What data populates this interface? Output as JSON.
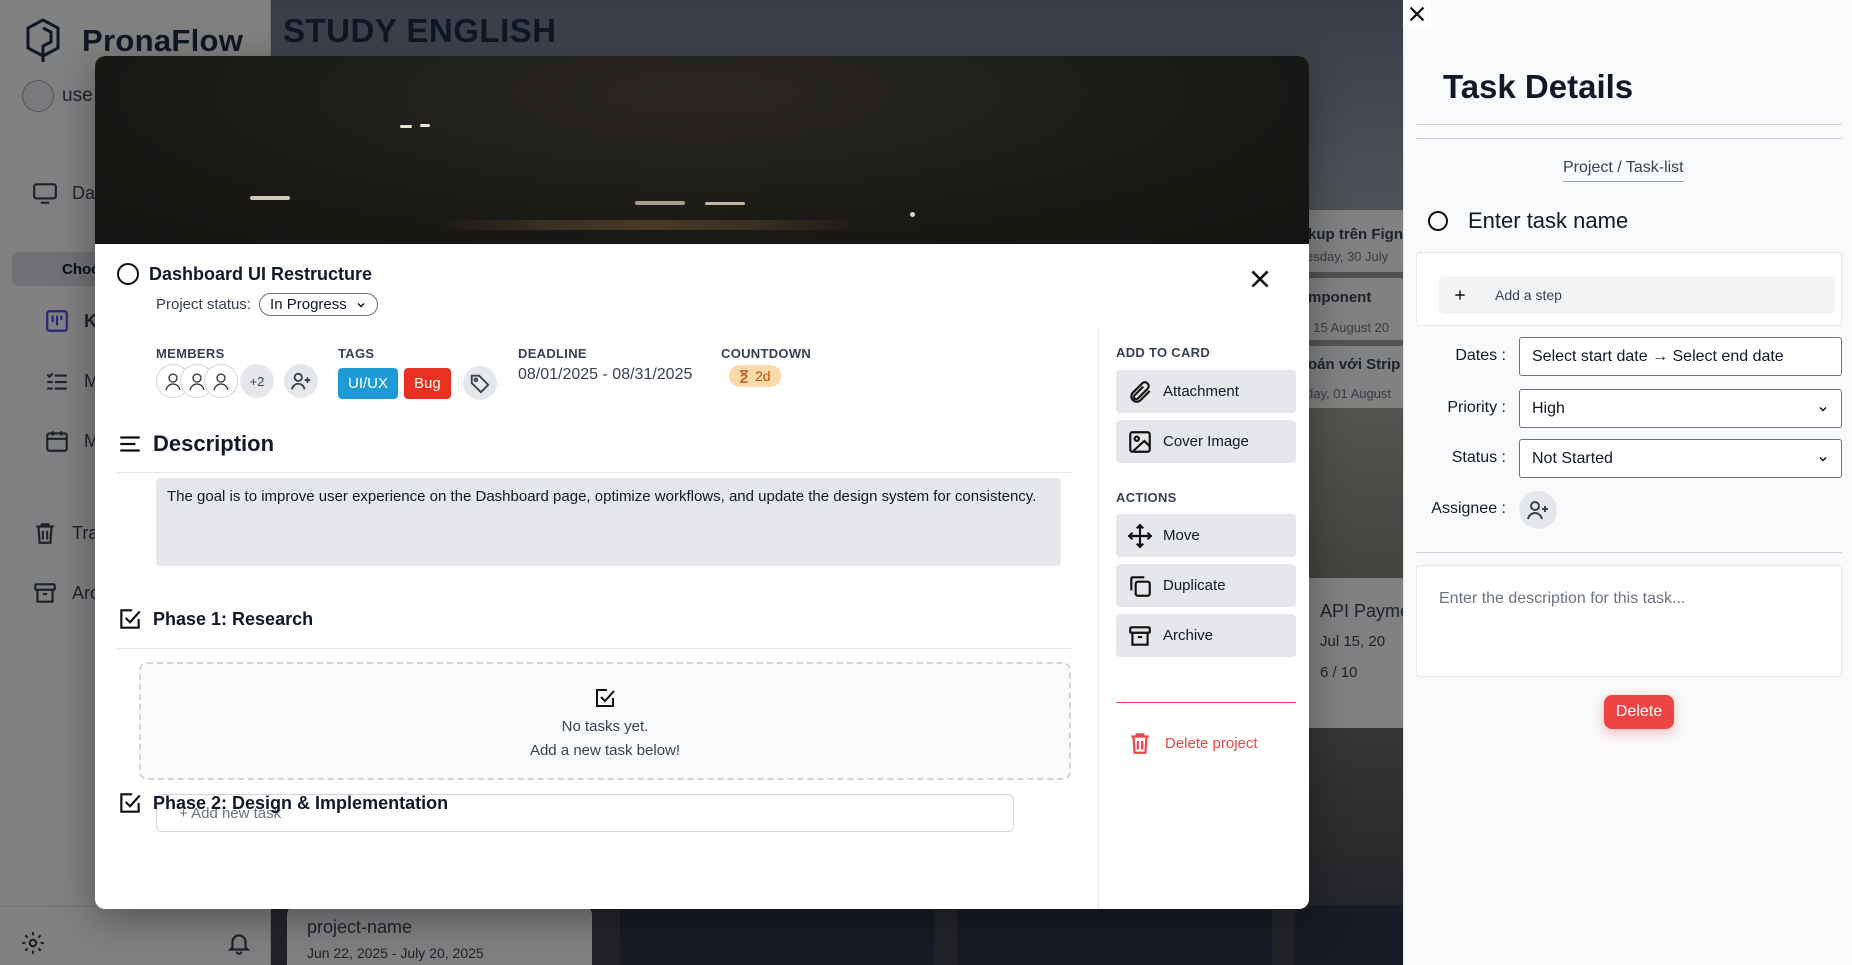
{
  "app": {
    "logo_text": "PronaFlow",
    "user_label": "use",
    "board_title": "STUDY ENGLISH",
    "sidebar": [
      {
        "label": "Das"
      },
      {
        "label": "Choo"
      },
      {
        "label": "Ka"
      },
      {
        "label": "M"
      },
      {
        "label": "M"
      },
      {
        "label": "Tra"
      },
      {
        "label": "Arc"
      }
    ],
    "background_cards": {
      "card_a": "kup trên Fign",
      "card_a_date": "esday, 30 July",
      "card_b": "mponent",
      "card_b_date": ", 15 August 20",
      "card_c": "oán với Strip",
      "card_c_date": "day, 01 August",
      "card_d": "API Payme",
      "card_d_date": "Jul 15, 20",
      "card_d_progress": "6 / 10",
      "card_e": "project-name",
      "card_e_date": "Jun 22, 2025 - July 20, 2025"
    }
  },
  "modal": {
    "title": "Dashboard UI Restructure",
    "status_label": "Project status:",
    "status_value": "In Progress",
    "members_label": "MEMBERS",
    "members_extra": "+2",
    "tags_label": "TAGS",
    "tags": [
      {
        "label": "UI/UX",
        "color": "#1e9bd7"
      },
      {
        "label": "Bug",
        "color": "#e8321f"
      }
    ],
    "deadline_label": "DEADLINE",
    "deadline_value": "08/01/2025 - 08/31/2025",
    "countdown_label": "COUNTDOWN",
    "countdown_value": "2d",
    "description_title": "Description",
    "description_text": "The goal is to improve user experience on the Dashboard page, optimize workflows, and update the design system for consistency.",
    "phase1_title": "Phase 1: Research",
    "empty_line1": "No tasks yet.",
    "empty_line2": "Add a new task below!",
    "add_task_placeholder": "+ Add new task",
    "phase2_title": "Phase 2: Design & Implementation",
    "add_to_card_label": "ADD TO CARD",
    "attachment": "Attachment",
    "cover_image": "Cover Image",
    "actions_label": "ACTIONS",
    "move": "Move",
    "duplicate": "Duplicate",
    "archive": "Archive",
    "delete_project": "Delete project"
  },
  "panel": {
    "title": "Task Details",
    "breadcrumb": "Project / Task-list",
    "task_name_placeholder": "Enter task name",
    "add_step": "Add a step",
    "dates_label": "Dates :",
    "dates_value": "Select start date → Select end date",
    "priority_label": "Priority :",
    "priority_value": "High",
    "status_label": "Status :",
    "status_value": "Not Started",
    "assignee_label": "Assignee :",
    "description_placeholder": "Enter the description for this task...",
    "delete_label": "Delete"
  },
  "colors": {
    "danger": "#ef4444",
    "countdown_bg": "#fcd9a8",
    "countdown_text": "#b45309"
  }
}
